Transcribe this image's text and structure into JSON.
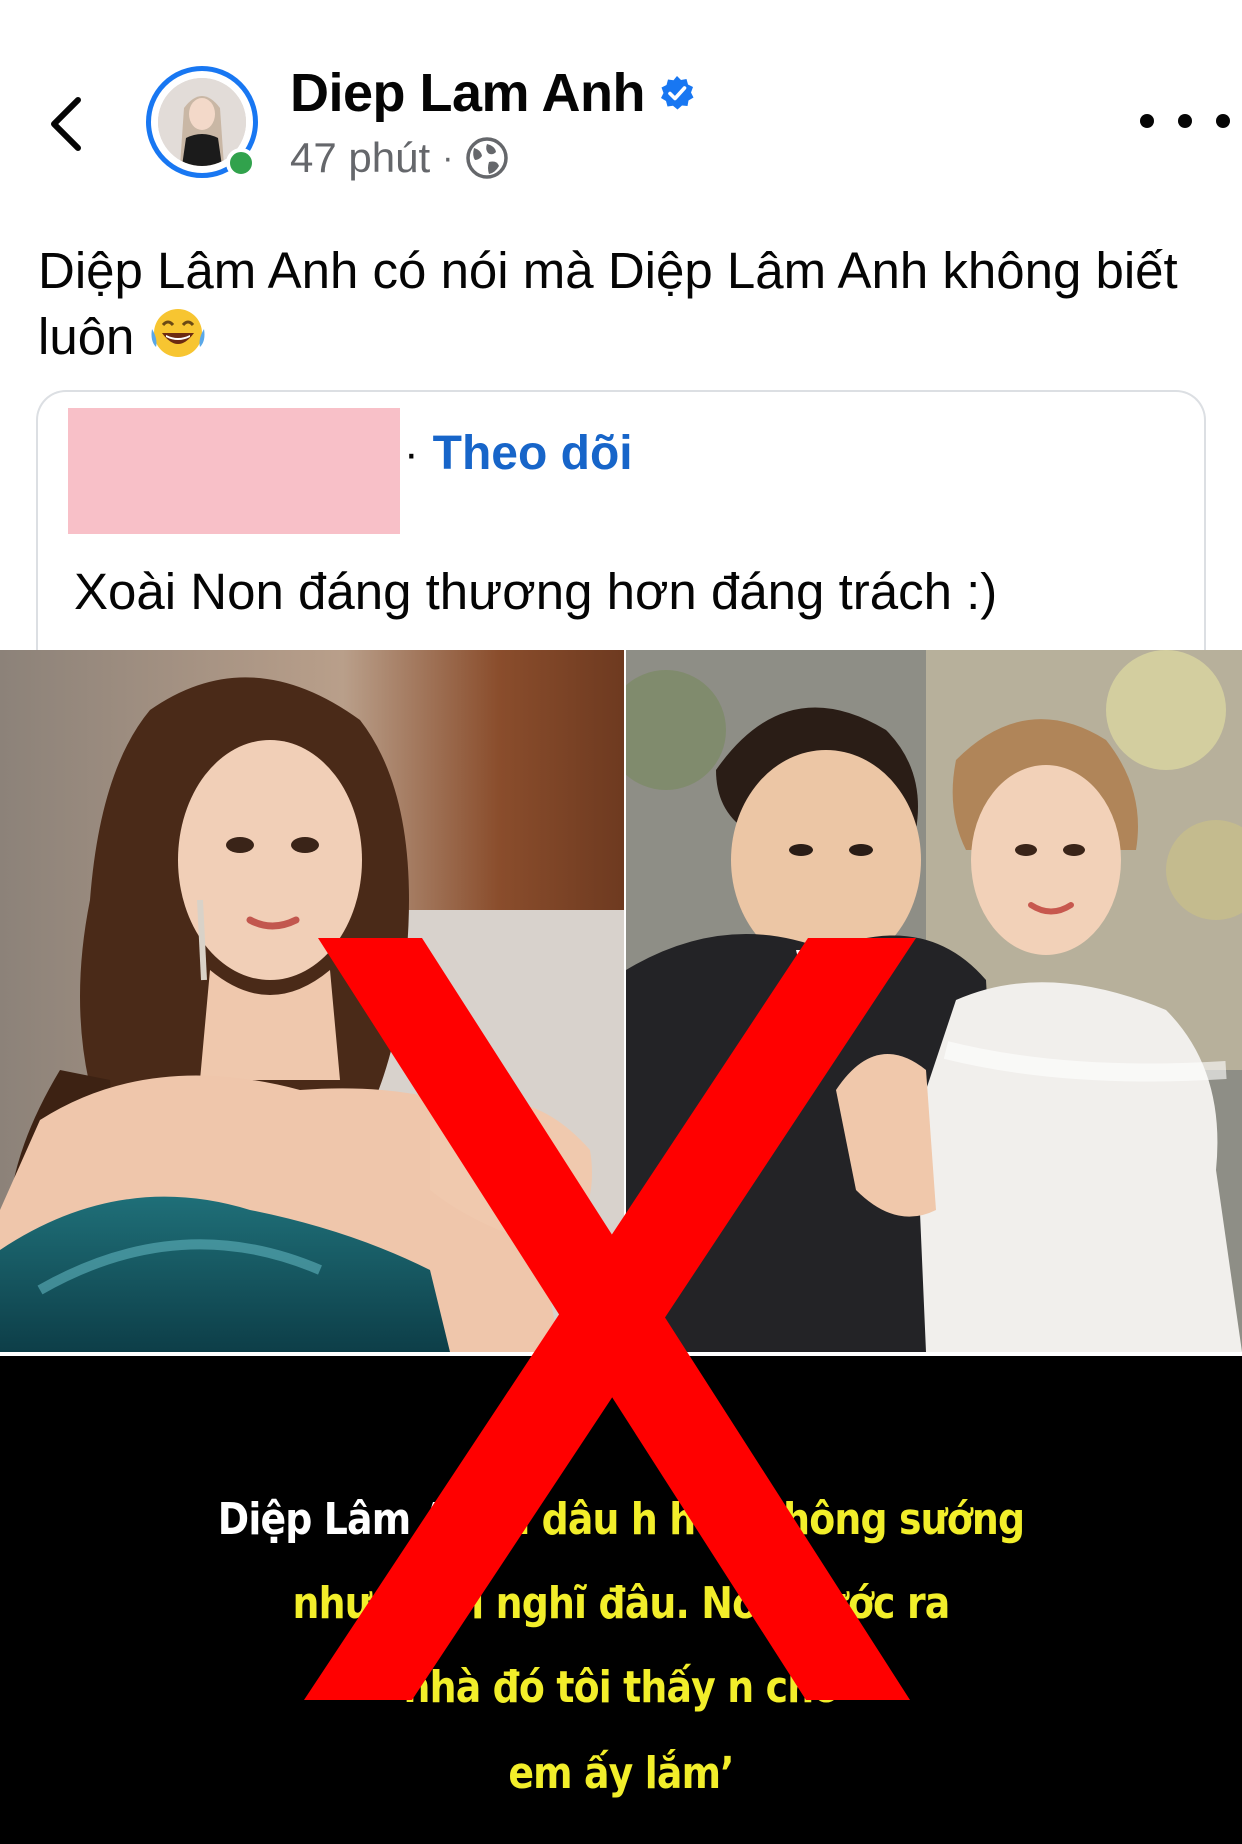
{
  "header": {
    "author_name": "Diep Lam Anh",
    "time": "47 phút",
    "separator": "·",
    "icons": {
      "back": "chevron-left-icon",
      "verified": "verified-badge-icon",
      "privacy": "globe-icon",
      "more": "more-dots-icon"
    },
    "accent_color": "#1877f2",
    "online_color": "#31a24c"
  },
  "post": {
    "caption": "Diệp Lâm Anh có nói mà Diệp Lâm Anh không biết luôn",
    "caption_emoji": "😂"
  },
  "shared_post": {
    "separator": "·",
    "follow_label": "Theo dõi",
    "text": "Xoài Non đáng thương hơn đáng trách :)",
    "follow_color": "#1765c9"
  },
  "image_overlay": {
    "line1_white": "Diệp Lâm Anh",
    "line1_yellow": "n dâu h   hôn không sướng",
    "line2": "như mọi    i nghĩ đâu.    Non bước ra",
    "line3": "    nhà đó tôi thấy n      cho",
    "line4": "em ấy lắm’",
    "text_color": "#f2ee2a"
  }
}
